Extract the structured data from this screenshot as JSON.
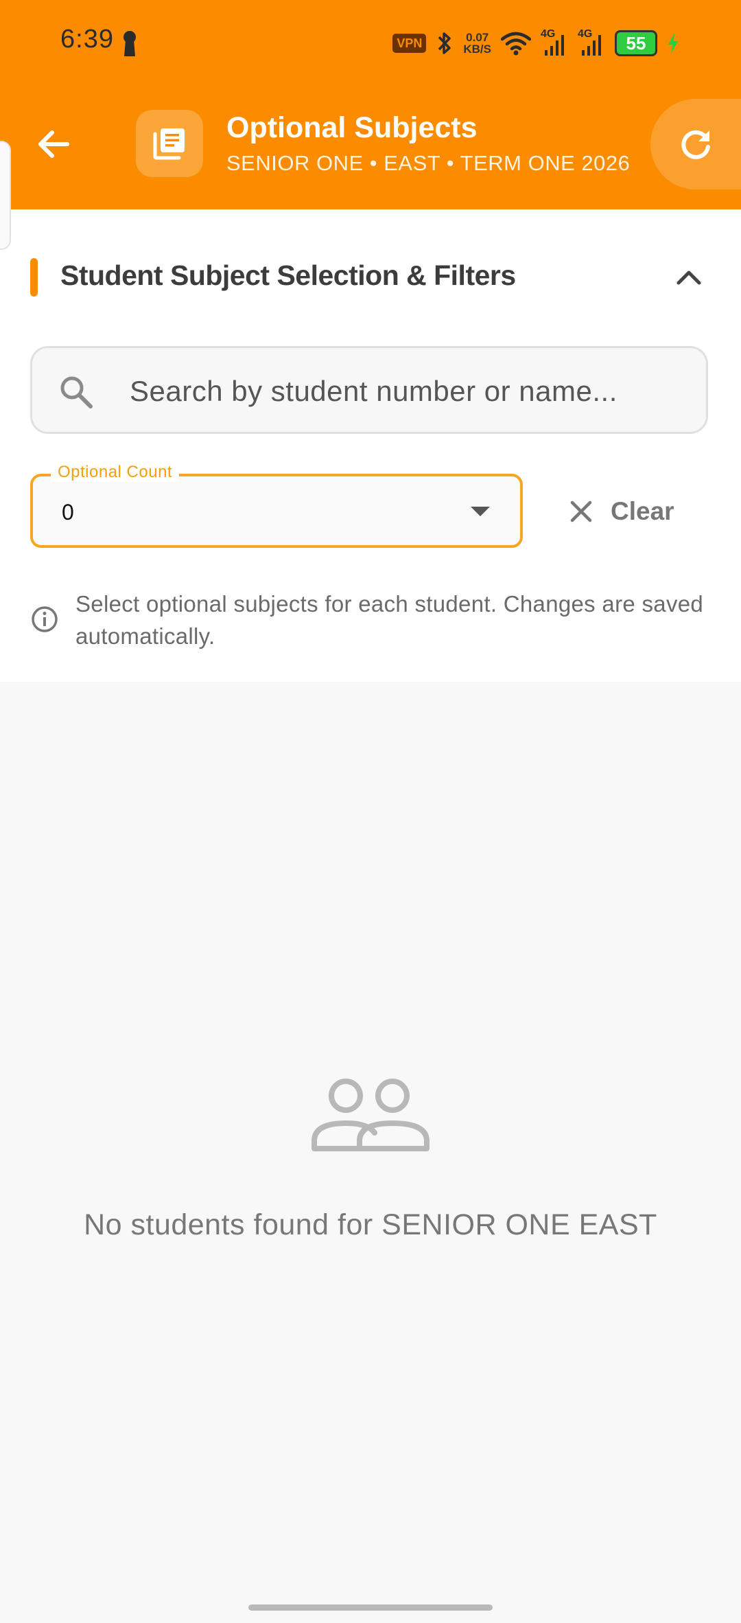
{
  "status_bar": {
    "time": "6:39",
    "vpn": "VPN",
    "speed_value": "0.07",
    "speed_unit": "KB/S",
    "network_1": "4G",
    "network_2": "4G",
    "battery": "55"
  },
  "header": {
    "title": "Optional Subjects",
    "subtitle": "SENIOR ONE • EAST • TERM ONE 2026",
    "accent_color": "#fb8c00"
  },
  "filters": {
    "section_title": "Student Subject Selection & Filters",
    "search_placeholder": "Search by student number or name...",
    "optional_count_label": "Optional Count",
    "optional_count_value": "0",
    "clear_label": "Clear",
    "info_text": "Select optional subjects for each student. Changes are saved automatically."
  },
  "empty_state": {
    "icon": "people-icon",
    "message": "No students found for SENIOR ONE EAST"
  },
  "icons": {
    "back": "arrow-left-icon",
    "title": "library-books-icon",
    "refresh": "refresh-icon",
    "collapse": "chevron-up-icon",
    "search": "search-icon",
    "dropdown": "caret-down-icon",
    "clear": "close-icon",
    "info": "info-icon"
  }
}
